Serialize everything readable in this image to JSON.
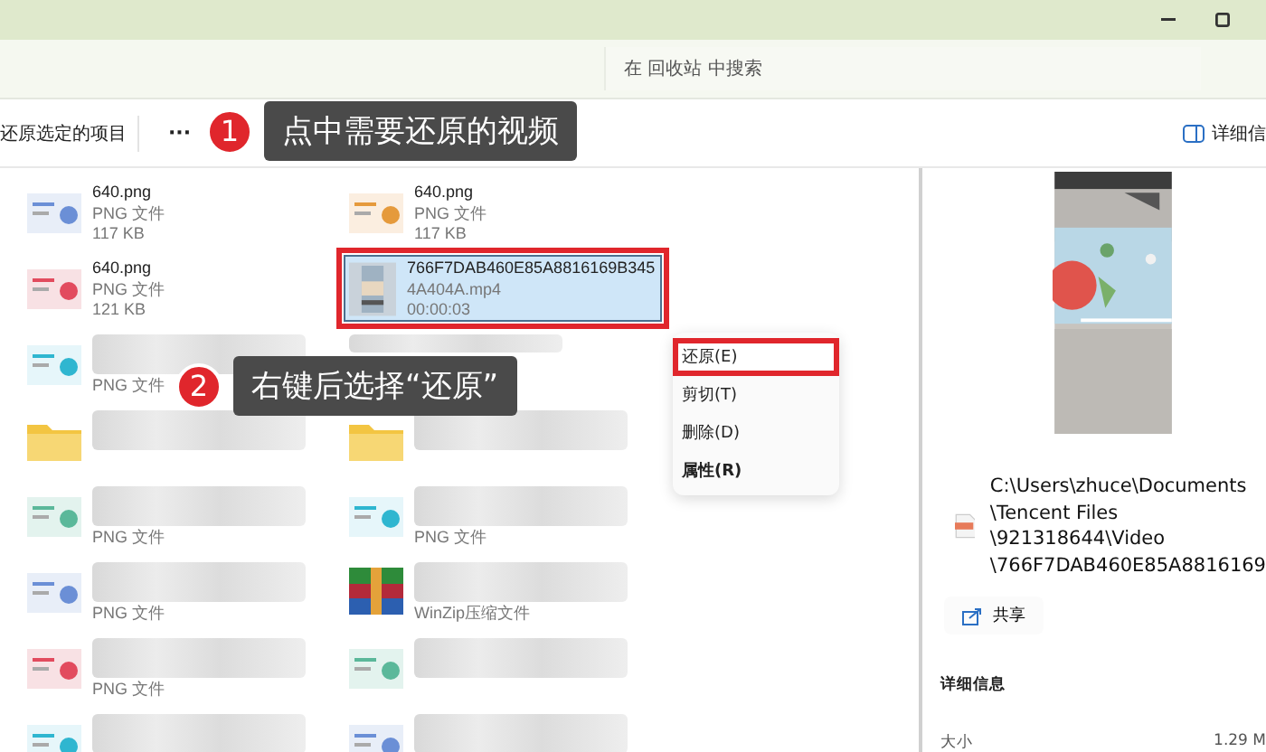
{
  "search": {
    "placeholder": "在 回收站 中搜索"
  },
  "toolbar": {
    "restore": "还原选定的项目",
    "more": "···",
    "details": "详细信"
  },
  "files": [
    {
      "kind": "png",
      "lines": [
        "640.png",
        "PNG 文件",
        "117 KB"
      ],
      "blurred": false,
      "selected": false,
      "highlighted": false
    },
    {
      "kind": "png",
      "lines": [
        "640.png",
        "PNG 文件",
        "117 KB"
      ],
      "blurred": false,
      "selected": false,
      "highlighted": false
    },
    {
      "kind": "png",
      "lines": [
        "640.png",
        "PNG 文件",
        "121 KB"
      ],
      "blurred": false,
      "selected": false,
      "highlighted": false
    },
    {
      "kind": "video",
      "lines": [
        "766F7DAB460E85A8816169B345",
        "4A404A.mp4",
        "00:00:03"
      ],
      "blurred": false,
      "selected": true,
      "highlighted": true
    },
    {
      "kind": "png",
      "lines": [
        "PNG 文件"
      ],
      "blurred": true,
      "selected": false,
      "highlighted": false
    },
    {
      "blurred": true,
      "selected": false,
      "highlighted": false
    },
    {
      "kind": "folder",
      "blurred": true,
      "selected": false,
      "highlighted": false
    },
    {
      "kind": "folder",
      "blurred": true,
      "selected": false,
      "highlighted": false
    },
    {
      "kind": "png",
      "lines": [
        "PNG 文件"
      ],
      "blurred": true,
      "selected": false,
      "highlighted": false
    },
    {
      "kind": "png",
      "lines": [
        "PNG 文件"
      ],
      "blurred": true,
      "selected": false,
      "highlighted": false
    },
    {
      "kind": "png",
      "lines": [
        "PNG 文件"
      ],
      "blurred": true,
      "selected": false,
      "highlighted": false
    },
    {
      "kind": "zip",
      "lines": [
        "WinZip压缩文件"
      ],
      "blurred": true,
      "selected": false,
      "highlighted": false
    },
    {
      "kind": "png",
      "lines": [
        "PNG 文件"
      ],
      "blurred": true,
      "selected": false,
      "highlighted": false
    },
    {
      "kind": "png",
      "blurred": true,
      "selected": false,
      "highlighted": false
    },
    {
      "kind": "png",
      "blurred": true,
      "selected": false,
      "highlighted": false
    },
    {
      "kind": "png",
      "blurred": true,
      "selected": false,
      "highlighted": false
    }
  ],
  "context_menu": [
    {
      "label": "还原(E)",
      "default": false,
      "highlighted": true
    },
    {
      "label": "剪切(T)",
      "default": false,
      "highlighted": false
    },
    {
      "label": "删除(D)",
      "default": false,
      "highlighted": false
    },
    {
      "label": "属性(R)",
      "default": true,
      "highlighted": false
    }
  ],
  "details_pane": {
    "path_lines": [
      "C:\\Users\\zhuce\\Documents",
      "\\Tencent Files",
      "\\921318644\\Video",
      "\\766F7DAB460E85A8816169"
    ],
    "share": "共享",
    "section": "详细信息",
    "size_label": "大小",
    "size_value": "1.29 M"
  },
  "annotations": [
    {
      "number": "1",
      "text": "点中需要还原的视频"
    },
    {
      "number": "2",
      "text": "右键后选择“还原”"
    }
  ]
}
